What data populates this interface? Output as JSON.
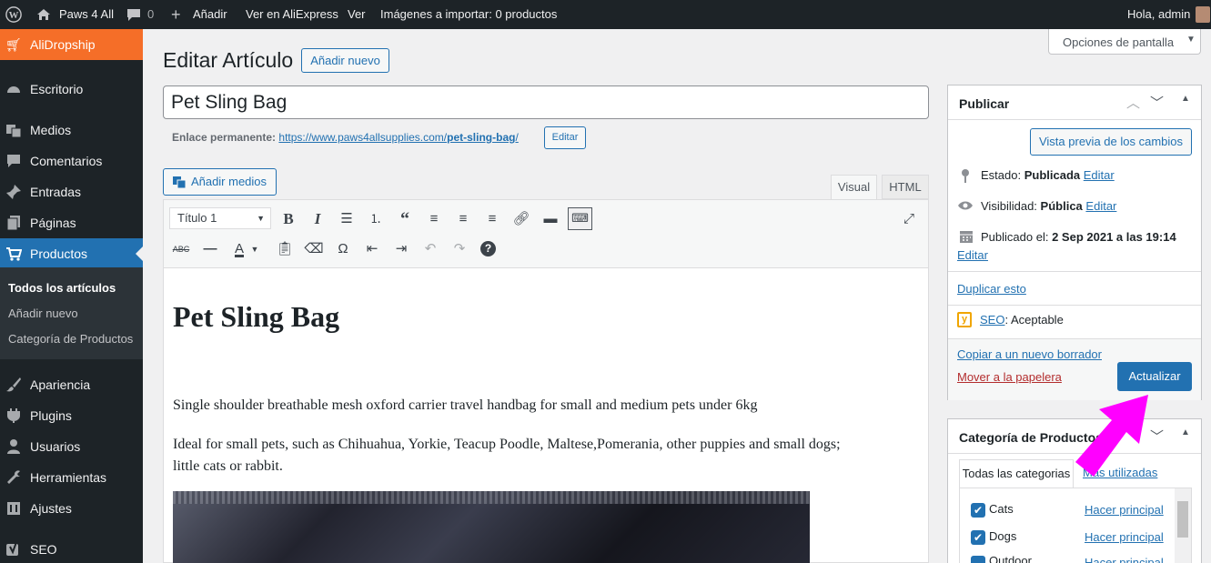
{
  "admin_bar": {
    "site_name": "Paws 4 All",
    "comments_count": "0",
    "add_new": "Añadir",
    "view_ali": "Ver en AliExpress",
    "view": "Ver",
    "import": "Imágenes a importar: 0 productos",
    "greeting": "Hola, admin"
  },
  "sidebar": {
    "plugin": "AliDropship",
    "items": [
      "Escritorio",
      "Medios",
      "Comentarios",
      "Entradas",
      "Páginas",
      "Productos",
      "Apariencia",
      "Plugins",
      "Usuarios",
      "Herramientas",
      "Ajustes",
      "SEO"
    ],
    "sub": [
      "Todos los artículos",
      "Añadir nuevo",
      "Categoría de Productos"
    ]
  },
  "screen_options": "Opciones de pantalla",
  "page": {
    "heading": "Editar Artículo",
    "add_new": "Añadir nuevo",
    "title_value": "Pet Sling Bag",
    "permalink_label": "Enlace permanente:",
    "permalink_base": "https://www.paws4allsupplies.com/",
    "permalink_slug": "pet-sling-bag",
    "permalink_end": "/",
    "edit": "Editar"
  },
  "editor": {
    "add_media": "Añadir medios",
    "tab_visual": "Visual",
    "tab_html": "HTML",
    "format_select": "Título 1",
    "content_heading": "Pet Sling Bag",
    "para1": "Single shoulder breathable mesh oxford carrier travel handbag for small and medium pets under 6kg",
    "para2a": "Ideal for small pets, such as Chihuahua, Yorkie, Teacup Poodle, Maltese,Pomerania, other puppies and small dogs;",
    "para2b": "little cats or rabbit."
  },
  "publish": {
    "title": "Publicar",
    "preview": "Vista previa de los cambios",
    "status_label": "Estado:",
    "status_value": "Publicada",
    "visibility_label": "Visibilidad:",
    "visibility_value": "Pública",
    "published_label": "Publicado el:",
    "published_value": "2 Sep 2021 a las 19:14",
    "edit": "Editar",
    "duplicate": "Duplicar esto",
    "seo_label": "SEO",
    "seo_value": ": Aceptable",
    "copy_draft": "Copiar a un nuevo borrador",
    "trash": "Mover a la papelera",
    "update": "Actualizar"
  },
  "categories": {
    "title": "Categoría de Productos",
    "tab_all": "Todas las categorias",
    "tab_used": "Más utilizadas",
    "make_primary": "Hacer principal",
    "items": [
      "Cats",
      "Dogs",
      "Outdoor"
    ]
  },
  "colors": {
    "accent": "#2271b1",
    "admin_bg": "#1d2327",
    "alidropship": "#f56e28",
    "arrow": "#ff00ff"
  }
}
